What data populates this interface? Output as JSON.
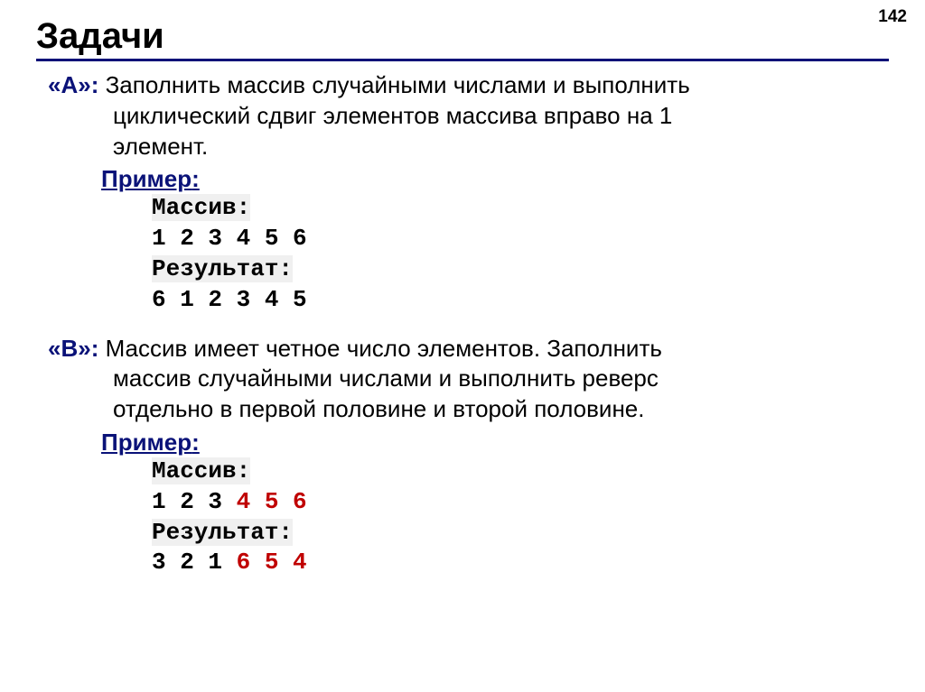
{
  "page_number": "142",
  "title": "Задачи",
  "task_a": {
    "label": "«A»:",
    "desc_first": " Заполнить массив случайными числами и выполнить",
    "desc_l2": "циклический сдвиг элементов массива вправо на 1",
    "desc_l3": "элемент.",
    "example_label": "Пример",
    "array_label": "Массив:",
    "array_values": "1 2 3 4 5 6",
    "result_label": "Результат:",
    "result_values": "6 1 2 3 4 5"
  },
  "task_b": {
    "label": "«B»:",
    "desc_first": " Массив имеет четное число элементов. Заполнить",
    "desc_l2": "массив случайными числами и выполнить реверс",
    "desc_l3": "отдельно в первой половине и второй половине.",
    "example_label": "Пример",
    "array_label": "Массив:",
    "array_values_p1": "1 2 3 ",
    "array_values_p2": "4 5 6",
    "result_label": "Результат:",
    "result_values_p1": "3 2 1 ",
    "result_values_p2": "6 5 4"
  }
}
